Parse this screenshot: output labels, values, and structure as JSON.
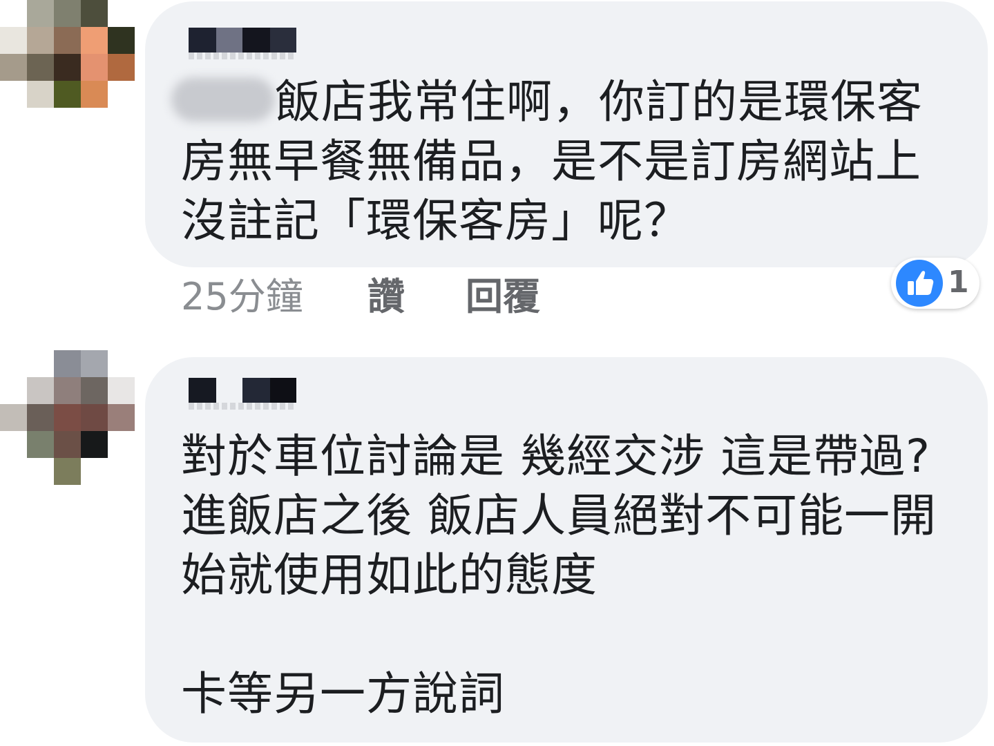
{
  "comments": [
    {
      "text": "飯店我常住啊，你訂的是環保客\n房無早餐無備品，是不是訂房網站上\n沒註記「環保客房」呢？",
      "timestamp": "25分鐘",
      "like_label": "讚",
      "reply_label": "回覆",
      "reaction": {
        "icon": "thumbs-up-icon",
        "count": "1",
        "color": "#2d88ff"
      }
    },
    {
      "text": "對於車位討論是 幾經交涉 這是帶過?\n進飯店之後 飯店人員絕對不可能一開\n始就使用如此的態度\n\n卡等另一方說詞"
    }
  ]
}
